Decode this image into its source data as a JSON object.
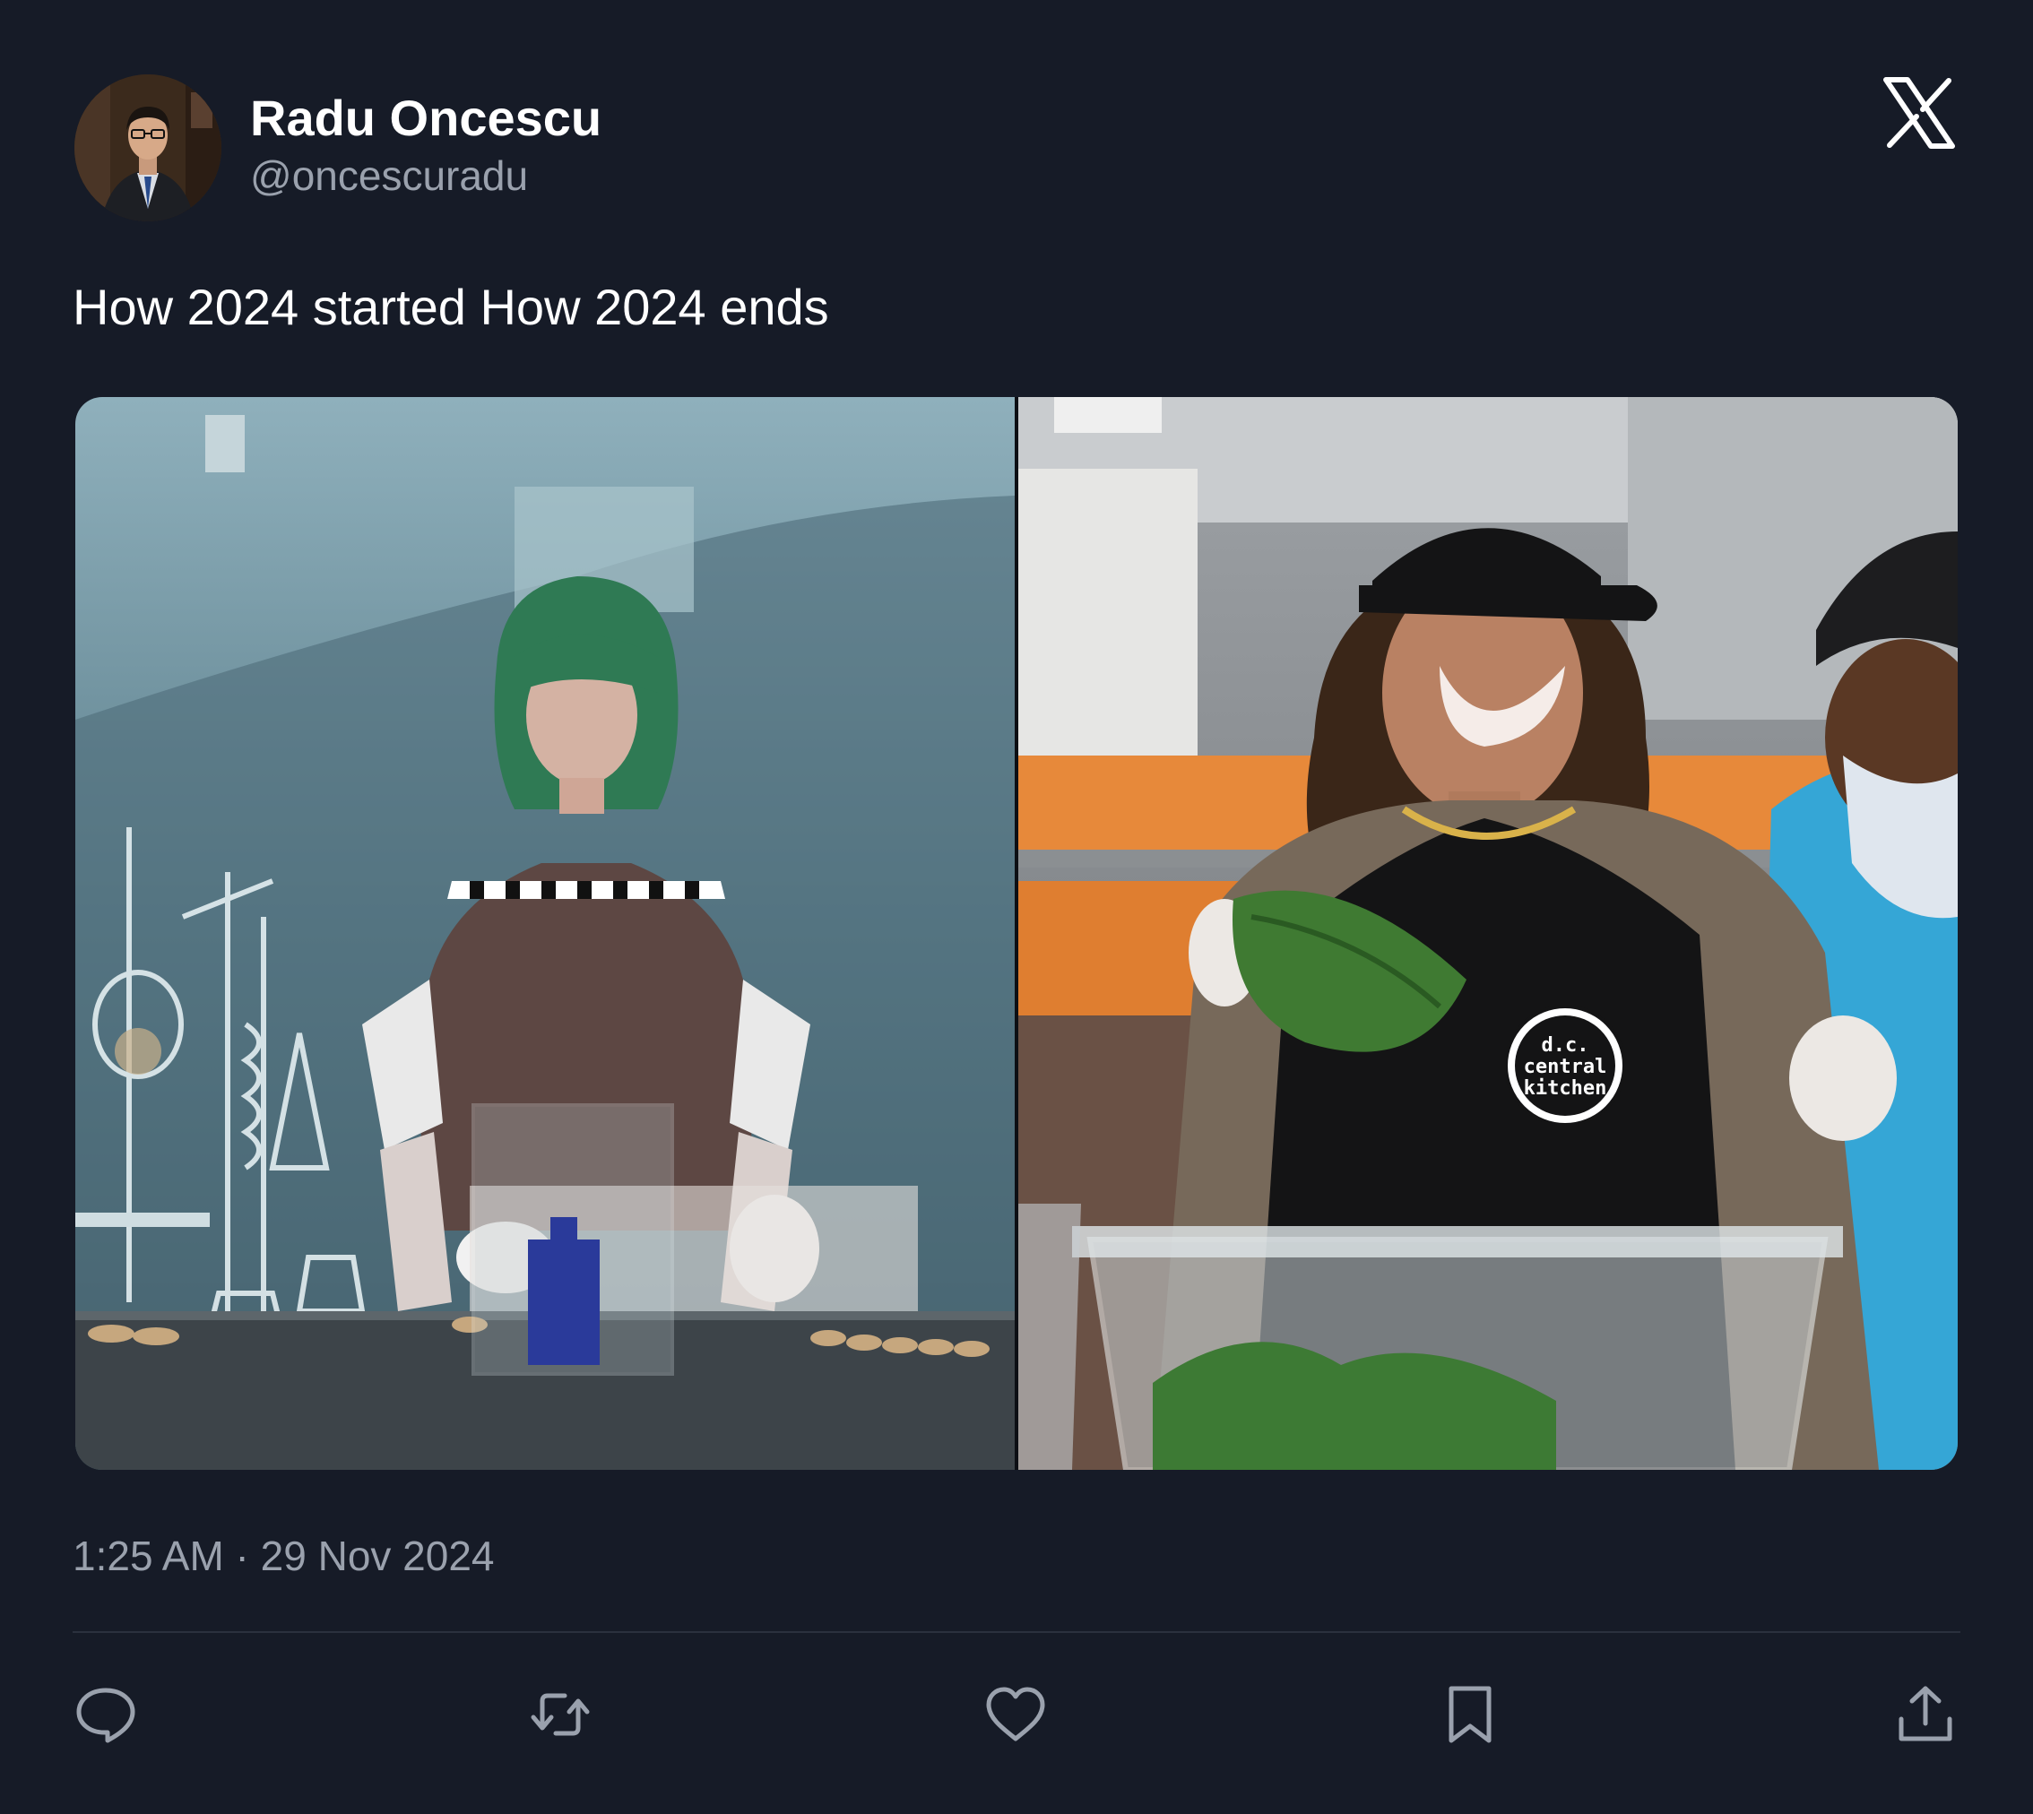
{
  "author": {
    "display_name": "Radu Oncescu",
    "handle": "@oncescuradu",
    "avatar_icon": "profile-photo"
  },
  "platform": {
    "logo_icon": "x-logo"
  },
  "tweet": {
    "text": "How 2024 started How 2024 ends",
    "timestamp": "1:25 AM · 29 Nov 2024",
    "media": {
      "left_image": {
        "icon": "photo-person-green-wig-lab"
      },
      "right_image": {
        "icon": "photo-kitchen-volunteers",
        "apron_logo_lines": [
          "d.c.",
          "central",
          "kitchen"
        ]
      }
    }
  },
  "actions": [
    {
      "name": "reply",
      "icon": "reply-icon"
    },
    {
      "name": "retweet",
      "icon": "retweet-icon"
    },
    {
      "name": "like",
      "icon": "heart-icon"
    },
    {
      "name": "bookmark",
      "icon": "bookmark-icon"
    },
    {
      "name": "share",
      "icon": "share-icon"
    }
  ],
  "colors": {
    "background": "#161b27",
    "primary_text": "#ffffff",
    "secondary_text": "#9aa1ad",
    "divider": "#2b313e"
  }
}
